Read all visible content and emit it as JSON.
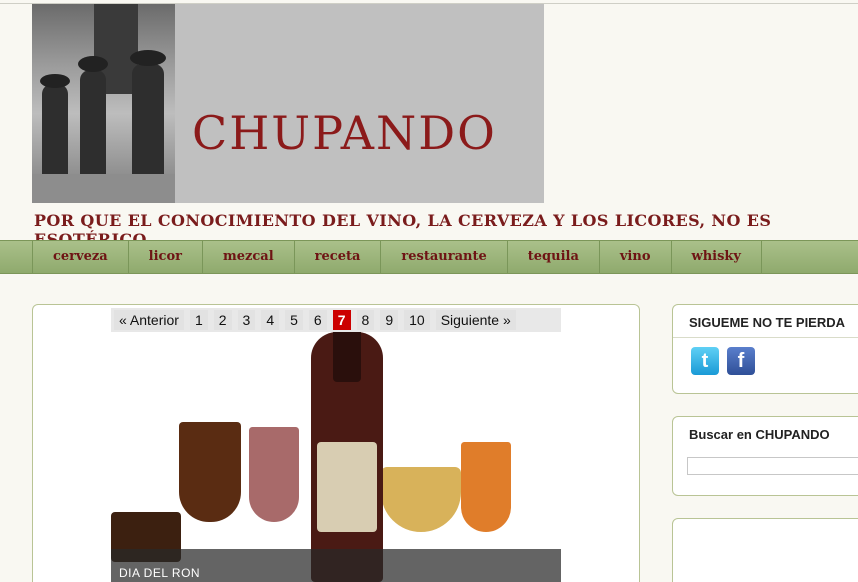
{
  "header": {
    "brand": "CHUPANDO",
    "tagline": "POR QUE EL CONOCIMIENTO DEL VINO, LA CERVEZA Y LOS LICORES, NO ES ESOTÉRICO"
  },
  "nav": {
    "items": [
      "cerveza",
      "licor",
      "mezcal",
      "receta",
      "restaurante",
      "tequila",
      "vino",
      "whisky"
    ]
  },
  "pager": {
    "prev": "« Anterior",
    "pages": [
      "1",
      "2",
      "3",
      "4",
      "5",
      "6",
      "7",
      "8",
      "9",
      "10"
    ],
    "current": "7",
    "next": "Siguiente »"
  },
  "slide": {
    "caption": "DIA DEL RON"
  },
  "sidebar": {
    "follow_title": "SIGUEME NO TE PIERDA",
    "search_title": "Buscar en CHUPANDO",
    "social": [
      "twitter-icon",
      "facebook-icon"
    ]
  },
  "colors": {
    "brand": "#8b1a1a",
    "nav_bg": "#97b074",
    "current_page": "#cc0000"
  }
}
